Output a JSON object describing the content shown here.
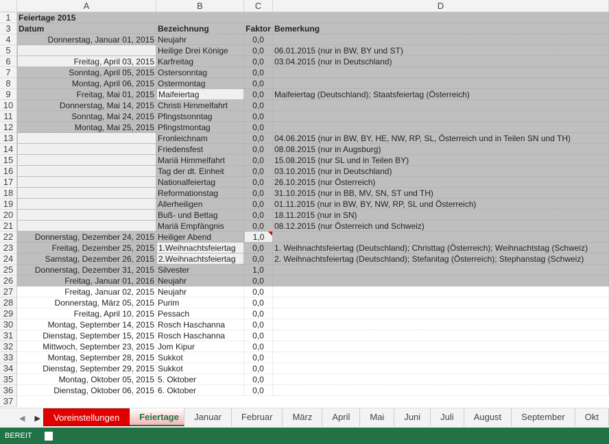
{
  "columns": [
    "A",
    "B",
    "C",
    "D"
  ],
  "title": "Feiertage 2015",
  "headers": {
    "a": "Datum",
    "b": "Bezeichnung",
    "c": "Faktor",
    "d": "Bemerkung"
  },
  "rows": [
    {
      "n": "4",
      "a": "Donnerstag, Januar 01, 2015",
      "b": "Neujahr",
      "c": "0,0",
      "d": ""
    },
    {
      "n": "5",
      "a": "",
      "b": "Heilige Drei Könige",
      "c": "0,0",
      "d": "06.01.2015 (nur in BW, BY und ST)"
    },
    {
      "n": "6",
      "a": "Freitag, April 03, 2015",
      "b": "Karfreitag",
      "c": "0,0",
      "d": "03.04.2015 (nur in Deutschland)"
    },
    {
      "n": "7",
      "a": "Sonntag, April 05, 2015",
      "b": "Ostersonntag",
      "c": "0,0",
      "d": ""
    },
    {
      "n": "8",
      "a": "Montag, April 06, 2015",
      "b": "Ostermontag",
      "c": "0,0",
      "d": ""
    },
    {
      "n": "9",
      "a": "Freitag, Mai 01, 2015",
      "b": "Maifeiertag",
      "c": "0,0",
      "d": "Maifeiertag (Deutschland); Staatsfeiertag (Österreich)"
    },
    {
      "n": "10",
      "a": "Donnerstag, Mai 14, 2015",
      "b": "Christi Himmelfahrt",
      "c": "0,0",
      "d": ""
    },
    {
      "n": "11",
      "a": "Sonntag, Mai 24, 2015",
      "b": "Pfingstsonntag",
      "c": "0,0",
      "d": ""
    },
    {
      "n": "12",
      "a": "Montag, Mai 25, 2015",
      "b": "Pfingstmontag",
      "c": "0,0",
      "d": ""
    },
    {
      "n": "13",
      "a": "",
      "b": "Fronleichnam",
      "c": "0,0",
      "d": "04.06.2015 (nur in BW, BY, HE, NW, RP, SL, Österreich und in Teilen SN und TH)"
    },
    {
      "n": "14",
      "a": "",
      "b": "Friedensfest",
      "c": "0,0",
      "d": "08.08.2015 (nur in Augsburg)"
    },
    {
      "n": "15",
      "a": "",
      "b": "Mariä Himmelfahrt",
      "c": "0,0",
      "d": "15.08.2015 (nur SL und in Teilen BY)"
    },
    {
      "n": "16",
      "a": "",
      "b": "Tag der dt. Einheit",
      "c": "0,0",
      "d": "03.10.2015 (nur in Deutschland)"
    },
    {
      "n": "17",
      "a": "",
      "b": "Nationalfeiertag",
      "c": "0,0",
      "d": "26.10.2015 (nur Österreich)"
    },
    {
      "n": "18",
      "a": "",
      "b": "Reformationstag",
      "c": "0,0",
      "d": "31.10.2015 (nur in BB, MV, SN, ST und TH)"
    },
    {
      "n": "19",
      "a": "",
      "b": "Allerheiligen",
      "c": "0,0",
      "d": "01.11.2015 (nur in BW, BY, NW, RP, SL und Österreich)"
    },
    {
      "n": "20",
      "a": "",
      "b": "Buß- und Bettag",
      "c": "0,0",
      "d": "18.11.2015 (nur in SN)"
    },
    {
      "n": "21",
      "a": "",
      "b": "Mariä Empfängnis",
      "c": "0,0",
      "d": "08.12.2015 (nur Österreich und Schweiz)"
    },
    {
      "n": "22",
      "a": "Donnerstag, Dezember 24, 2015",
      "b": "Heiliger Abend",
      "c": "1,0",
      "d": ""
    },
    {
      "n": "23",
      "a": "Freitag, Dezember 25, 2015",
      "b": "1.Weihnachtsfeiertag",
      "c": "0,0",
      "d": "1. Weihnachtsfeiertag (Deutschland); Christtag (Österreich); Weihnachtstag (Schweiz)"
    },
    {
      "n": "24",
      "a": "Samstag, Dezember 26, 2015",
      "b": "2.Weihnachtsfeiertag",
      "c": "0,0",
      "d": "2. Weihnachtsfeiertag (Deutschland); Stefanitag (Österreich); Stephanstag (Schweiz)"
    },
    {
      "n": "25",
      "a": "Donnerstag, Dezember 31, 2015",
      "b": "Silvester",
      "c": "1,0",
      "d": ""
    },
    {
      "n": "26",
      "a": "Freitag, Januar 01, 2016",
      "b": "Neujahr",
      "c": "0,0",
      "d": ""
    },
    {
      "n": "27",
      "a": "Freitag, Januar 02, 2015",
      "b": "Neujahr",
      "c": "0,0",
      "d": ""
    },
    {
      "n": "28",
      "a": "Donnerstag, März 05, 2015",
      "b": "Purim",
      "c": "0,0",
      "d": ""
    },
    {
      "n": "29",
      "a": "Freitag, April 10, 2015",
      "b": "Pessach",
      "c": "0,0",
      "d": ""
    },
    {
      "n": "30",
      "a": "Montag, September 14, 2015",
      "b": "Rosch Haschanna",
      "c": "0,0",
      "d": ""
    },
    {
      "n": "31",
      "a": "Dienstag, September 15, 2015",
      "b": "Rosch Haschanna",
      "c": "0,0",
      "d": ""
    },
    {
      "n": "32",
      "a": "Mittwoch, September 23, 2015",
      "b": "Jom Kipur",
      "c": "0,0",
      "d": ""
    },
    {
      "n": "33",
      "a": "Montag, September 28, 2015",
      "b": "Sukkot",
      "c": "0,0",
      "d": ""
    },
    {
      "n": "34",
      "a": "Dienstag, September 29, 2015",
      "b": "Sukkot",
      "c": "0,0",
      "d": ""
    },
    {
      "n": "35",
      "a": "Montag, Oktober 05, 2015",
      "b": "5. Oktober",
      "c": "0,0",
      "d": ""
    },
    {
      "n": "36",
      "a": "Dienstag, Oktober 06, 2015",
      "b": "6. Oktober",
      "c": "0,0",
      "d": ""
    }
  ],
  "tabs": [
    "Voreinstellungen",
    "Feiertage",
    "Januar",
    "Februar",
    "März",
    "April",
    "Mai",
    "Juni",
    "Juli",
    "August",
    "September",
    "Okt"
  ],
  "status": "BEREIT"
}
